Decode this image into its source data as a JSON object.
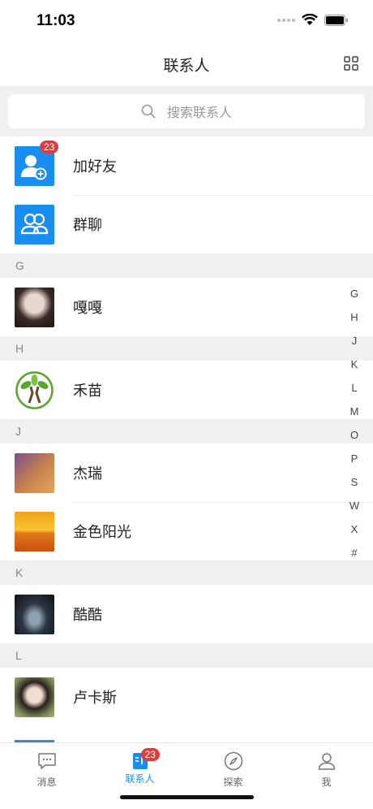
{
  "status": {
    "time": "11:03"
  },
  "header": {
    "title": "联系人"
  },
  "search": {
    "placeholder": "搜索联系人"
  },
  "top_items": [
    {
      "name": "加好友",
      "badge": "23"
    },
    {
      "name": "群聊"
    }
  ],
  "sections": [
    {
      "letter": "G",
      "contacts": [
        {
          "name": "嘎嘎"
        }
      ]
    },
    {
      "letter": "H",
      "contacts": [
        {
          "name": "禾苗"
        }
      ]
    },
    {
      "letter": "J",
      "contacts": [
        {
          "name": "杰瑞"
        },
        {
          "name": "金色阳光"
        }
      ]
    },
    {
      "letter": "K",
      "contacts": [
        {
          "name": "酷酷"
        }
      ]
    },
    {
      "letter": "L",
      "contacts": [
        {
          "name": "卢卡斯"
        }
      ]
    }
  ],
  "index_letters": [
    "G",
    "H",
    "J",
    "K",
    "L",
    "M",
    "O",
    "P",
    "S",
    "W",
    "X",
    "#"
  ],
  "tabs": [
    {
      "label": "消息",
      "icon": "message-icon"
    },
    {
      "label": "联系人",
      "icon": "contacts-icon",
      "badge": "23",
      "active": true
    },
    {
      "label": "探索",
      "icon": "compass-icon"
    },
    {
      "label": "我",
      "icon": "profile-icon"
    }
  ],
  "colors": {
    "accent": "#1a8ef0",
    "badge": "#e23b3b",
    "section_bg": "#f0f0f0"
  }
}
